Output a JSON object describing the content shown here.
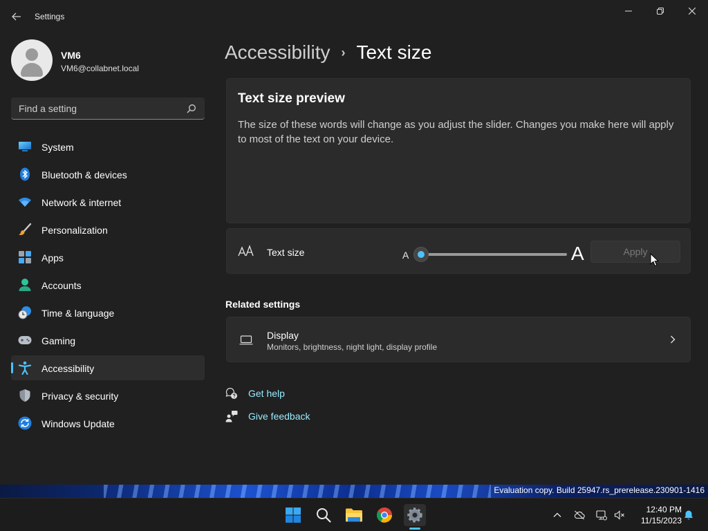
{
  "window": {
    "title": "Settings",
    "back_icon": "arrow-left-icon",
    "minimize_icon": "minimize-icon",
    "restore_icon": "restore-icon",
    "close_icon": "close-icon"
  },
  "profile": {
    "name": "VM6",
    "email": "VM6@collabnet.local"
  },
  "search": {
    "placeholder": "Find a setting",
    "icon": "search-icon"
  },
  "sidebar": {
    "accent_color": "#4cc2ff",
    "items": [
      {
        "label": "System",
        "icon": "system-icon",
        "active": false
      },
      {
        "label": "Bluetooth & devices",
        "icon": "bluetooth-icon",
        "active": false
      },
      {
        "label": "Network & internet",
        "icon": "wifi-icon",
        "active": false
      },
      {
        "label": "Personalization",
        "icon": "brush-icon",
        "active": false
      },
      {
        "label": "Apps",
        "icon": "apps-icon",
        "active": false
      },
      {
        "label": "Accounts",
        "icon": "person-icon",
        "active": false
      },
      {
        "label": "Time & language",
        "icon": "clock-globe-icon",
        "active": false
      },
      {
        "label": "Gaming",
        "icon": "gamepad-icon",
        "active": false
      },
      {
        "label": "Accessibility",
        "icon": "accessibility-icon",
        "active": true
      },
      {
        "label": "Privacy & security",
        "icon": "shield-icon",
        "active": false
      },
      {
        "label": "Windows Update",
        "icon": "update-icon",
        "active": false
      }
    ]
  },
  "breadcrumb": {
    "parent": "Accessibility",
    "separator": "›",
    "current": "Text size"
  },
  "preview": {
    "title": "Text size preview",
    "body": "The size of these words will change as you adjust the slider. Changes you make here will apply to most of the text on your device."
  },
  "text_size": {
    "label": "Text size",
    "icon": "text-size-icon",
    "small_a": "A",
    "large_a": "A",
    "slider_value_percent": 100,
    "slider_position_fraction": 0.0,
    "apply_label": "Apply",
    "apply_enabled": false
  },
  "related": {
    "title": "Related settings",
    "display": {
      "title": "Display",
      "subtitle": "Monitors, brightness, night light, display profile",
      "icon": "laptop-icon",
      "chevron": "chevron-right-icon"
    }
  },
  "links": {
    "help": "Get help",
    "help_icon": "help-chat-icon",
    "feedback": "Give feedback",
    "feedback_icon": "feedback-icon",
    "link_color": "#99ebff"
  },
  "desktop": {
    "watermark": "Evaluation copy. Build 25947.rs_prerelease.230901-1416"
  },
  "taskbar": {
    "apps": [
      {
        "name": "start-icon"
      },
      {
        "name": "search-icon"
      },
      {
        "name": "file-explorer-icon"
      },
      {
        "name": "chrome-icon"
      },
      {
        "name": "settings-icon",
        "active": true
      }
    ],
    "tray": [
      "chevron-up-icon",
      "cloud-off-icon",
      "network-icon",
      "volume-muted-icon",
      "bell-icon"
    ],
    "time": "12:40 PM",
    "date": "11/15/2023"
  }
}
